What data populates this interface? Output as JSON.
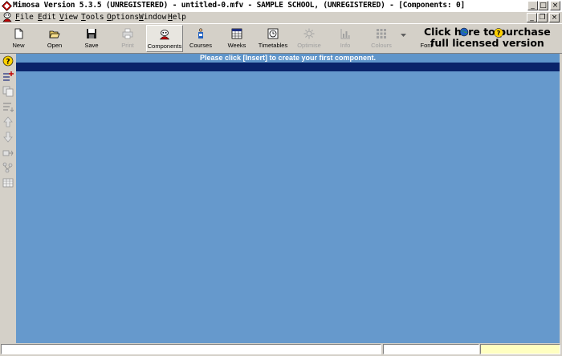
{
  "window": {
    "title": "Mimosa Version 5.3.5 (UNREGISTERED) - untitled-0.mfv - SAMPLE SCHOOL, (UNREGISTERED) - [Components: 0]",
    "minimize_glyph": "_",
    "maximize_glyph": "□",
    "close_glyph": "×"
  },
  "menu": {
    "items": [
      {
        "hotkey": "F",
        "rest": "ile"
      },
      {
        "hotkey": "E",
        "rest": "dit"
      },
      {
        "hotkey": "V",
        "rest": "iew"
      },
      {
        "hotkey": "T",
        "rest": "ools"
      },
      {
        "hotkey": "O",
        "rest": "ptions"
      },
      {
        "hotkey": "W",
        "rest": "indow"
      },
      {
        "hotkey": "H",
        "rest": "elp"
      }
    ],
    "mdi_minimize_glyph": "_",
    "mdi_restore_glyph": "❐",
    "mdi_close_glyph": "×"
  },
  "toolbar": {
    "new": "New",
    "open": "Open",
    "save": "Save",
    "print": "Print",
    "components": "Components",
    "courses": "Courses",
    "weeks": "Weeks",
    "timetables": "Timetables",
    "optimise": "Optimise",
    "info": "Info",
    "colours": "Colours",
    "font": "Font",
    "promo_line1": "Click here to purchase",
    "promo_line2": "full licensed version"
  },
  "content": {
    "hint": "Please click [Insert] to create your first component."
  },
  "colors": {
    "content_bg": "#6699cc",
    "selection_bar": "#0a246a",
    "status_highlight": "#ffffc0"
  }
}
